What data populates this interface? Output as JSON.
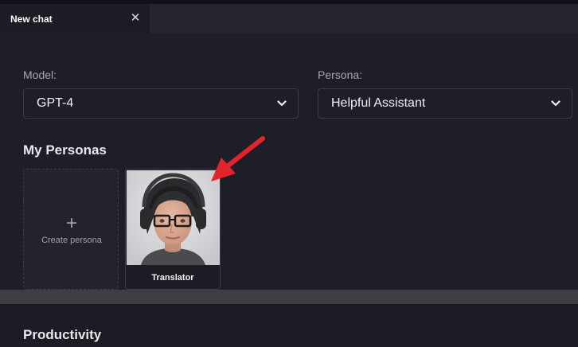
{
  "tab": {
    "title": "New chat",
    "close_glyph": "✕"
  },
  "model": {
    "label": "Model:",
    "value": "GPT-4"
  },
  "persona": {
    "label": "Persona:",
    "value": "Helpful Assistant"
  },
  "my_personas": {
    "title": "My Personas",
    "create": {
      "plus": "+",
      "label": "Create persona"
    },
    "items": [
      {
        "name": "Translator",
        "avatar_icon": "woman-headphones-avatar"
      }
    ]
  },
  "productivity": {
    "title": "Productivity"
  },
  "colors": {
    "background": "#1d1e27",
    "annotation_arrow": "#e5232a"
  }
}
